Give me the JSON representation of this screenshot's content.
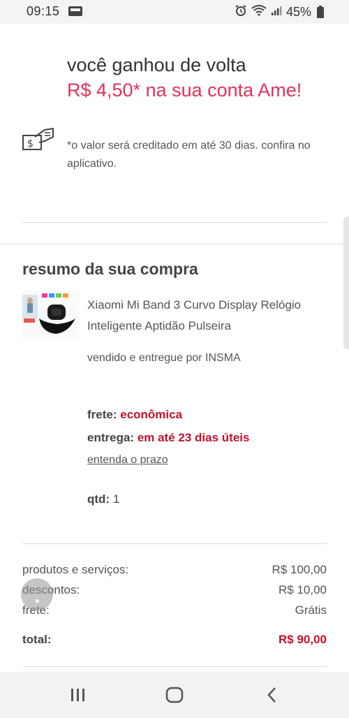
{
  "status_bar": {
    "time": "09:15",
    "battery": "45%"
  },
  "cashback": {
    "title": "você ganhou de volta",
    "amount": "R$ 4,50* na sua conta Ame!",
    "note": "*o valor será creditado em até 30 dias. confira no aplicativo.",
    "icon": "cash-hand-icon"
  },
  "summary": {
    "title": "resumo da sua compra",
    "product": {
      "thumbnail": "product-thumbnail-smartband",
      "name": "Xiaomi Mi Band 3 Curvo Display Relógio Inteligente Aptidão Pulseira",
      "seller": "vendido e entregue por INSMA"
    },
    "shipping": {
      "label": "frete:",
      "value": "econômica",
      "delivery_label": "entrega:",
      "delivery_value": "em até 23 dias úteis",
      "deadline_link": "entenda o prazo"
    },
    "quantity": {
      "label": "qtd:",
      "value": "1"
    }
  },
  "totals": {
    "rows": [
      {
        "label": "produtos e serviços:",
        "value": "R$ 100,00"
      },
      {
        "label": "descontos:",
        "value": "R$ 10,00"
      },
      {
        "label": "frete:",
        "value": "Grátis"
      }
    ],
    "total_label": "total:",
    "total_value": "R$ 90,00"
  },
  "colors": {
    "accent": "#e0325b",
    "highlight": "#c4102b"
  },
  "nav": {
    "recents": "recents-icon",
    "home": "home-icon",
    "back": "back-icon"
  }
}
